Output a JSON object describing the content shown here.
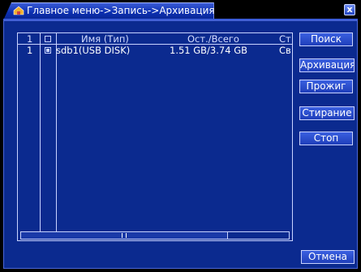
{
  "window": {
    "title": "Главное меню->Запись->Архивация",
    "close_label": "x"
  },
  "table": {
    "headers": [
      "1",
      "",
      "Имя (Тип)",
      "Ост./Всего",
      "Ст"
    ],
    "rows": [
      {
        "num": "1",
        "checked": true,
        "name": "sdb1(USB DISK)",
        "space": "1.51 GB/3.74 GB",
        "status": "Св"
      }
    ]
  },
  "buttons": {
    "search": "Поиск",
    "archive": "Архивация",
    "burn": "Прожиг",
    "erase": "Стирание",
    "stop": "Стоп",
    "cancel": "Отмена"
  },
  "colors": {
    "panel": "#0b2a8f",
    "title_bar": "#0b2fb0",
    "border": "#c8d2ff"
  }
}
